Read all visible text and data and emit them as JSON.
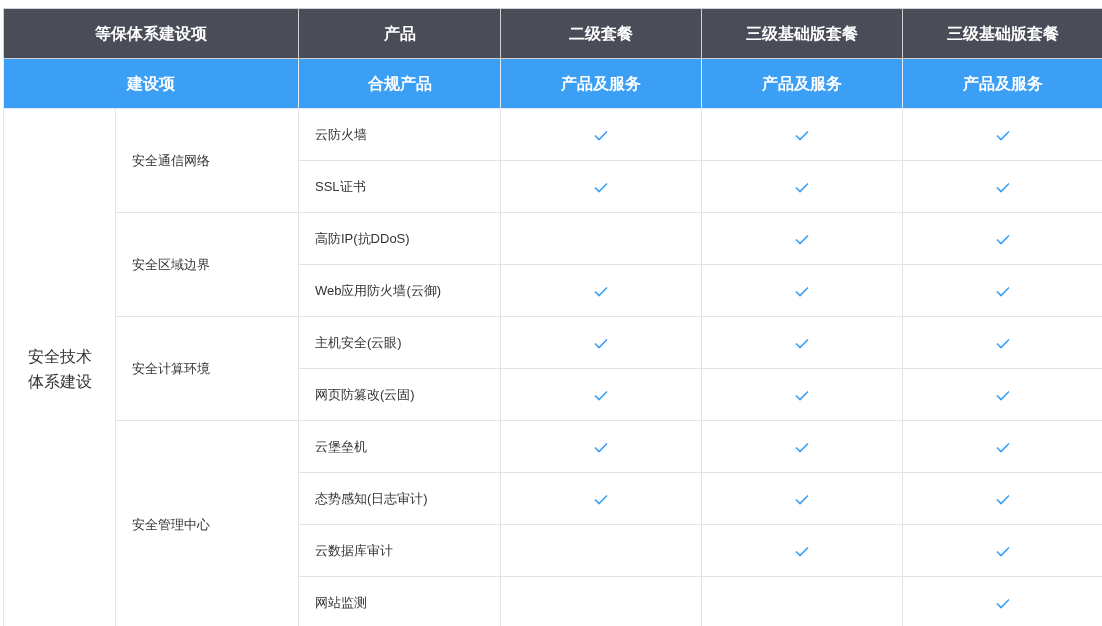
{
  "header_row_1": [
    "等保体系建设项",
    "产品",
    "二级套餐",
    "三级基础版套餐",
    "三级基础版套餐"
  ],
  "header_row_2": [
    "建设项",
    "合规产品",
    "产品及服务",
    "产品及服务",
    "产品及服务"
  ],
  "sections": [
    {
      "label": "安全技术体系建设",
      "groups": [
        {
          "label": "安全通信网络",
          "products": [
            {
              "name": "云防火墙",
              "checked": [
                true,
                true,
                true
              ]
            },
            {
              "name": "SSL证书",
              "checked": [
                true,
                true,
                true
              ]
            }
          ]
        },
        {
          "label": "安全区域边界",
          "products": [
            {
              "name": "高防IP(抗DDoS)",
              "checked": [
                false,
                true,
                true
              ]
            },
            {
              "name": "Web应用防火墙(云御)",
              "checked": [
                true,
                true,
                true
              ]
            }
          ]
        },
        {
          "label": "安全计算环境",
          "products": [
            {
              "name": "主机安全(云眼)",
              "checked": [
                true,
                true,
                true
              ]
            },
            {
              "name": "网页防篡改(云固)",
              "checked": [
                true,
                true,
                true
              ]
            }
          ]
        },
        {
          "label": "安全管理中心",
          "products": [
            {
              "name": "云堡垒机",
              "checked": [
                true,
                true,
                true
              ]
            },
            {
              "name": "态势感知(日志审计)",
              "checked": [
                true,
                true,
                true
              ]
            },
            {
              "name": "云数据库审计",
              "checked": [
                false,
                true,
                true
              ]
            },
            {
              "name": "网站监测",
              "checked": [
                false,
                false,
                true
              ]
            }
          ]
        }
      ]
    }
  ]
}
